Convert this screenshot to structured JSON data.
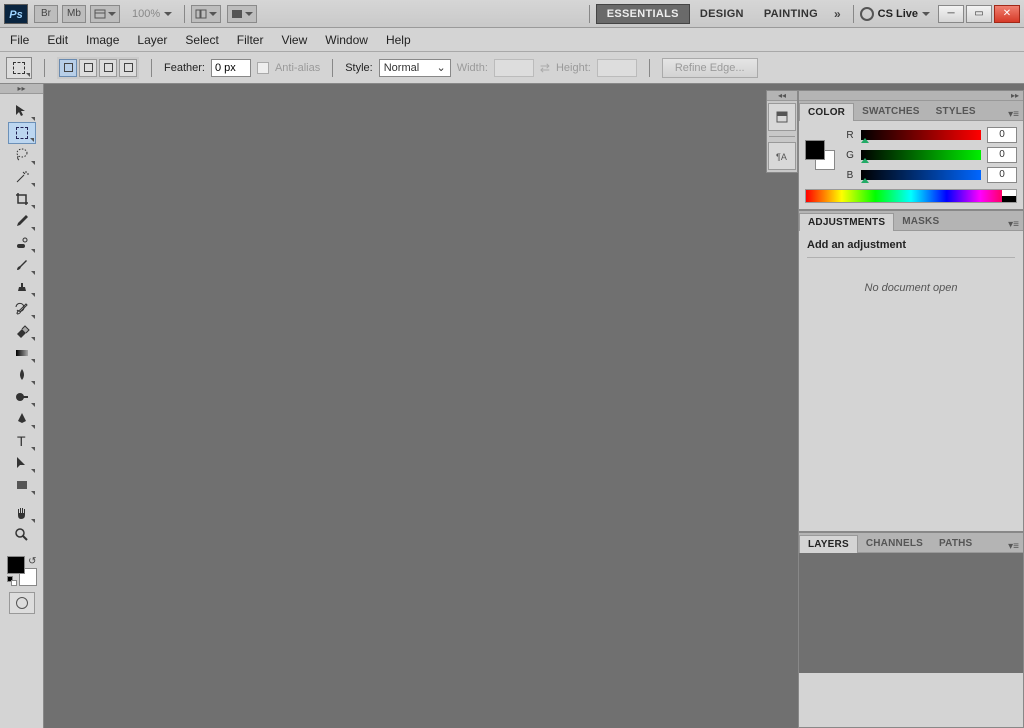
{
  "app": {
    "logo": "Ps",
    "chips": [
      "Br",
      "Mb"
    ],
    "zoom": "100%",
    "workspaces": [
      "ESSENTIALS",
      "DESIGN",
      "PAINTING"
    ],
    "activeWorkspace": "ESSENTIALS",
    "csLive": "CS Live"
  },
  "menu": [
    "File",
    "Edit",
    "Image",
    "Layer",
    "Select",
    "Filter",
    "View",
    "Window",
    "Help"
  ],
  "options": {
    "featherLabel": "Feather:",
    "featherValue": "0 px",
    "antiAlias": "Anti-alias",
    "styleLabel": "Style:",
    "styleValue": "Normal",
    "widthLabel": "Width:",
    "heightLabel": "Height:",
    "refine": "Refine Edge..."
  },
  "colorPanel": {
    "tabs": [
      "COLOR",
      "SWATCHES",
      "STYLES"
    ],
    "active": "COLOR",
    "r": {
      "label": "R",
      "value": "0"
    },
    "g": {
      "label": "G",
      "value": "0"
    },
    "b": {
      "label": "B",
      "value": "0"
    }
  },
  "adjustPanel": {
    "tabs": [
      "ADJUSTMENTS",
      "MASKS"
    ],
    "active": "ADJUSTMENTS",
    "heading": "Add an adjustment",
    "empty": "No document open"
  },
  "layersPanel": {
    "tabs": [
      "LAYERS",
      "CHANNELS",
      "PATHS"
    ],
    "active": "LAYERS"
  }
}
